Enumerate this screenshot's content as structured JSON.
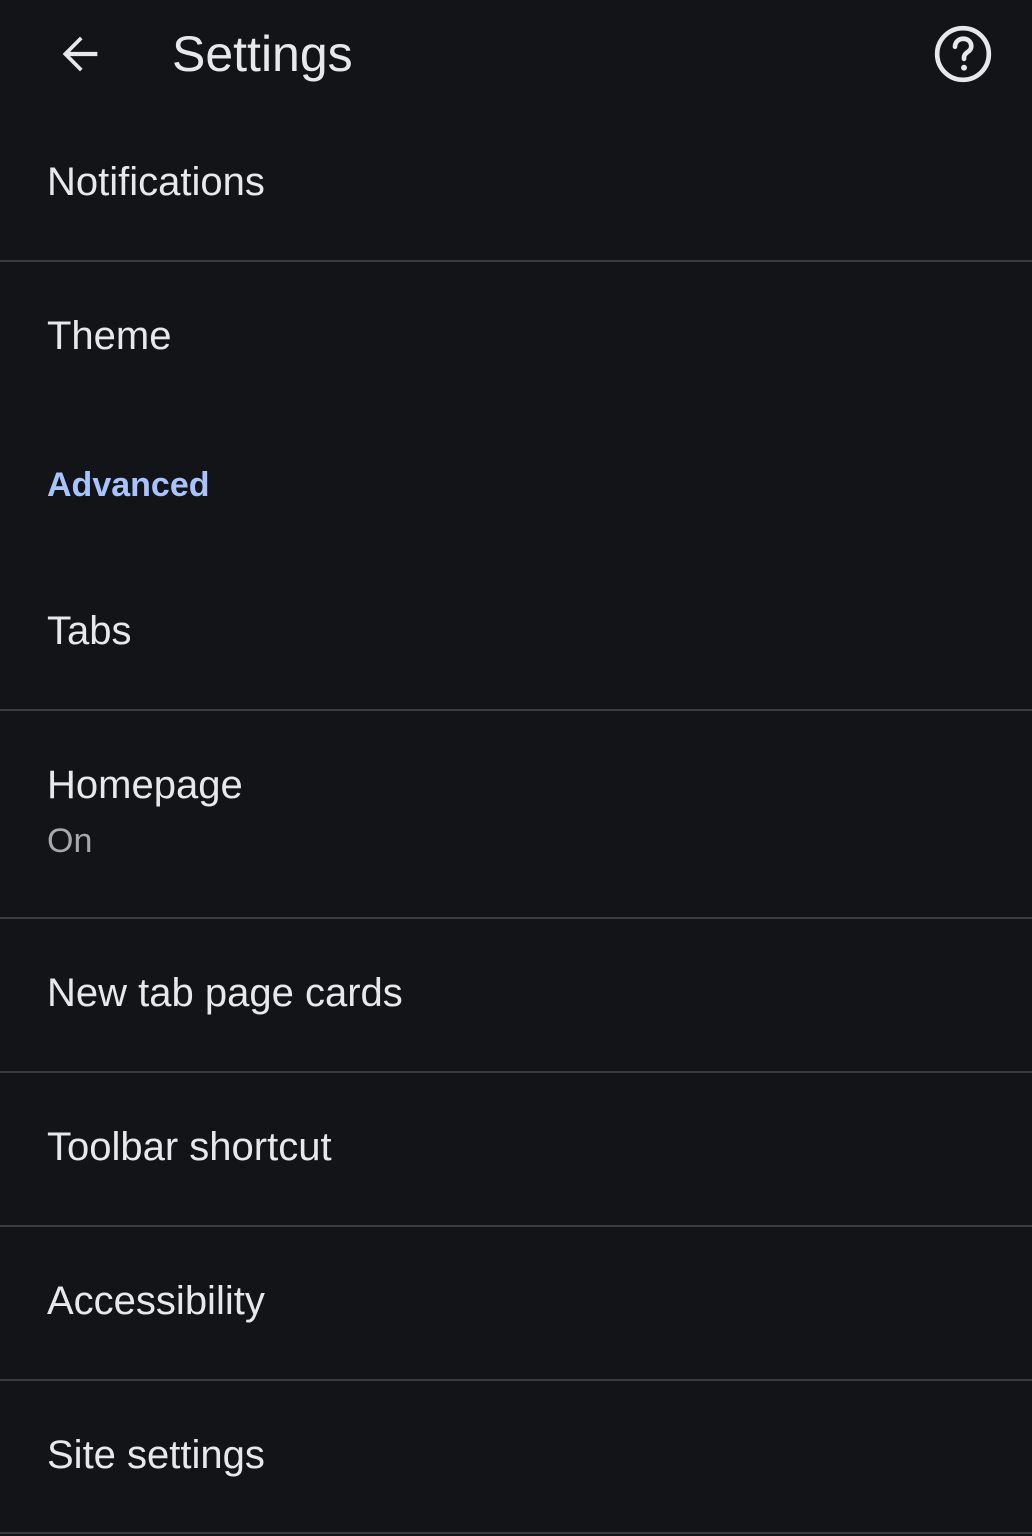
{
  "header": {
    "title": "Settings",
    "back_icon": "arrow-back-icon",
    "help_icon": "help-circle-icon"
  },
  "items": {
    "notifications": {
      "label": "Notifications"
    },
    "theme": {
      "label": "Theme"
    },
    "tabs": {
      "label": "Tabs"
    },
    "homepage": {
      "label": "Homepage",
      "sublabel": "On"
    },
    "new_tab_page_cards": {
      "label": "New tab page cards"
    },
    "toolbar_shortcut": {
      "label": "Toolbar shortcut"
    },
    "accessibility": {
      "label": "Accessibility"
    },
    "site_settings": {
      "label": "Site settings"
    }
  },
  "sections": {
    "advanced": "Advanced"
  },
  "colors": {
    "background": "#131418",
    "text": "#e7e8ec",
    "secondary_text": "#a6a8ae",
    "accent": "#a8c4ff",
    "divider": "#3a3b40"
  }
}
